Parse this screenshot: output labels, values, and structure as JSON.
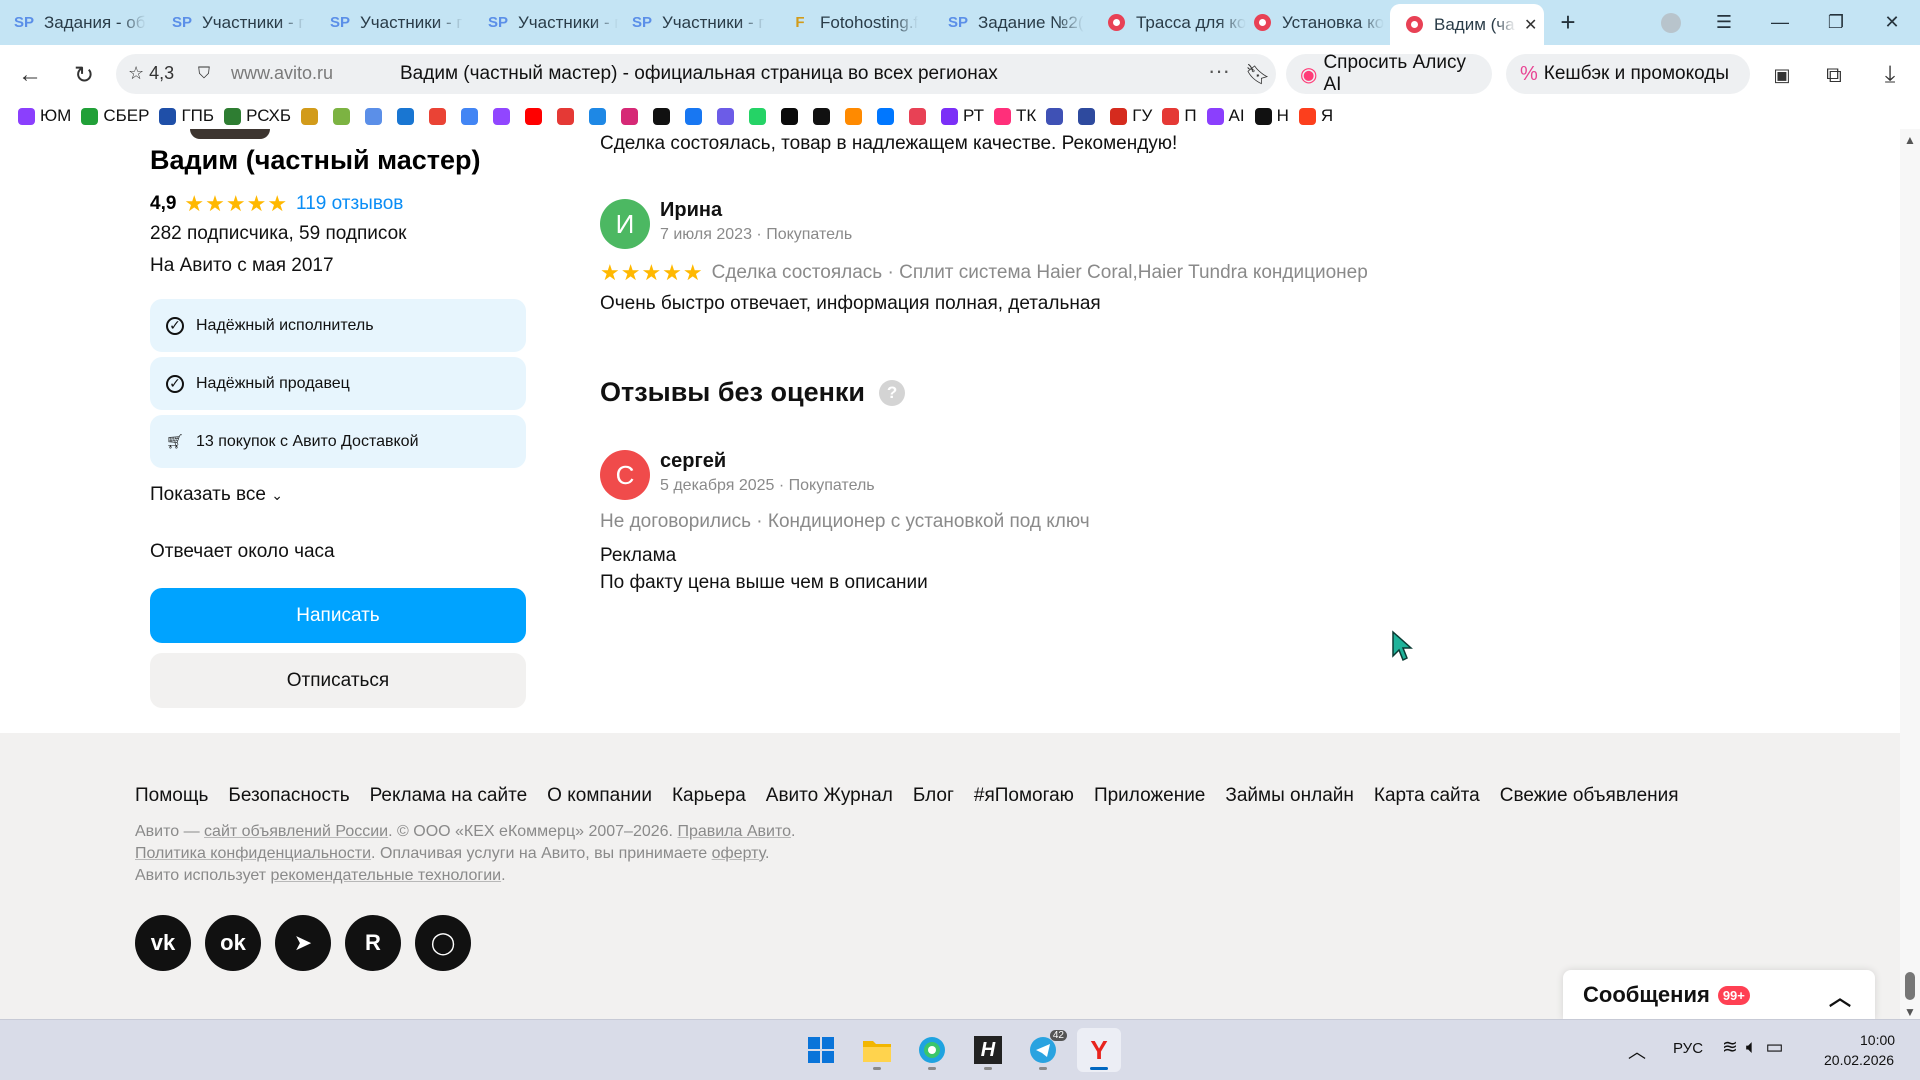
{
  "browser": {
    "tabs": [
      {
        "icon": "sp-icon",
        "title": "Задания - об"
      },
      {
        "icon": "sp-icon",
        "title": "Участники - г"
      },
      {
        "icon": "sp-icon",
        "title": "Участники - г"
      },
      {
        "icon": "sp-icon",
        "title": "Участники - г"
      },
      {
        "icon": "sp-icon",
        "title": "Участники - г"
      },
      {
        "icon": "fotohosting-icon",
        "title": "Fotohosting.f"
      },
      {
        "icon": "sp-icon",
        "title": "Задание №2("
      },
      {
        "icon": "avito-icon",
        "title": "Трасса для ко"
      },
      {
        "icon": "avito-icon",
        "title": "Установка ко"
      },
      {
        "icon": "avito-icon",
        "title": "Вадим (ча",
        "active": true
      }
    ],
    "address": {
      "rating": "4,3",
      "host": "www.avito.ru",
      "title": "Вадим (частный мастер) - официальная страница во всех регионах"
    },
    "alice_label": "Спросить Алису AI",
    "cashback_label": "Кешбэк и промокоды",
    "bookmarks": [
      {
        "label": "ЮМ",
        "color": "#8b3ffd"
      },
      {
        "label": "СБЕР",
        "color": "#21a038"
      },
      {
        "label": "ГПБ",
        "color": "#1f4fa8"
      },
      {
        "label": "РСХБ",
        "color": "#2e7d32"
      },
      {
        "label": "",
        "color": "#d29b1a"
      },
      {
        "label": "",
        "color": "#7cb342"
      },
      {
        "label": "",
        "color": "#5b8fe8"
      },
      {
        "label": "",
        "color": "#1976d2"
      },
      {
        "label": "",
        "color": "#ea4335"
      },
      {
        "label": "",
        "color": "#4285f4"
      },
      {
        "label": "",
        "color": "#9146ff"
      },
      {
        "label": "",
        "color": "#ff0000"
      },
      {
        "label": "",
        "color": "#e53935"
      },
      {
        "label": "",
        "color": "#1e88e5"
      },
      {
        "label": "",
        "color": "#d62976"
      },
      {
        "label": "",
        "color": "#111111"
      },
      {
        "label": "",
        "color": "#1877f2"
      },
      {
        "label": "",
        "color": "#6c5ce7"
      },
      {
        "label": "",
        "color": "#25d366"
      },
      {
        "label": "",
        "color": "#0a0a0a"
      },
      {
        "label": "",
        "color": "#111111"
      },
      {
        "label": "",
        "color": "#ff8a00"
      },
      {
        "label": "",
        "color": "#0077ff"
      },
      {
        "label": "",
        "color": "#e84155"
      },
      {
        "label": "РТ",
        "color": "#7b2ff7"
      },
      {
        "label": "ТК",
        "color": "#ff2f7a"
      },
      {
        "label": "",
        "color": "#3f51b5"
      },
      {
        "label": "",
        "color": "#2e4a9e"
      },
      {
        "label": "ГУ",
        "color": "#d52b1e"
      },
      {
        "label": "П",
        "color": "#e53935"
      },
      {
        "label": "AI",
        "color": "#8b3ffd"
      },
      {
        "label": "Н",
        "color": "#111111"
      },
      {
        "label": "Я",
        "color": "#fc3f1d"
      }
    ]
  },
  "seller": {
    "name": "Вадим (частный мастер)",
    "rating": "4,9",
    "stars": "★★★★★",
    "reviews_link": "119 отзывов",
    "subscribers": "282 подписчика, 59 подписок",
    "since": "На Авито с мая 2017",
    "badges": [
      {
        "icon": "check-circle-icon",
        "label": "Надёжный исполнитель"
      },
      {
        "icon": "check-circle-icon",
        "label": "Надёжный продавец"
      },
      {
        "icon": "cart-icon",
        "label": "13 покупок с Авито Доставкой"
      }
    ],
    "show_all": "Показать все",
    "responds": "Отвечает около часа",
    "write_button": "Написать",
    "unsubscribe_button": "Отписаться"
  },
  "reviews": {
    "prev_text": "Сделка состоялась, товар в надлежащем качестве. Рекомендую!",
    "irina": {
      "initial": "И",
      "name": "Ирина",
      "meta": "7 июля 2023 · Покупатель",
      "stars": "★★★★★",
      "deal": "Сделка состоялась · Сплит система Haier Coral,Haier Tundra кондиционер",
      "text": "Очень быстро отвечает, информация полная, детальная"
    },
    "no_score_title": "Отзывы без оценки",
    "help_icon": "?",
    "sergey": {
      "initial": "С",
      "name": "сергей",
      "meta": "5 декабря 2025 · Покупатель",
      "deal": "Не договорились · Кондиционер с установкой под ключ",
      "text_1": "Реклама",
      "text_2": "По факту цена выше чем в описании"
    }
  },
  "footer": {
    "links": [
      "Помощь",
      "Безопасность",
      "Реклама на сайте",
      "О компании",
      "Карьера",
      "Авито Журнал",
      "Блог",
      "#яПомогаю",
      "Приложение",
      "Займы онлайн",
      "Карта сайта",
      "Свежие объявления"
    ],
    "line1_a": "Авито — ",
    "line1_link1": "сайт объявлений России",
    "line1_b": ". © ООО «КЕХ еКоммерц» 2007–2026. ",
    "line1_link2": "Правила Авито",
    "line1_c": ".",
    "line2_link1": "Политика конфиденциальности",
    "line2_b": ". Оплачивая услуги на Авито, вы принимаете ",
    "line2_link2": "оферту",
    "line2_c": ".",
    "line3_a": "Авито использует ",
    "line3_link": "рекомендательные технологии",
    "line3_c": ".",
    "social": [
      "vk-icon",
      "ok-icon",
      "telegram-icon",
      "rutube-icon",
      "max-icon"
    ]
  },
  "messages": {
    "label": "Сообщения",
    "count": "99+"
  },
  "taskbar": {
    "apps": [
      "windows-start-icon",
      "file-explorer-icon",
      "edge-icon",
      "h-app-icon",
      "telegram-icon",
      "yandex-browser-icon"
    ],
    "telegram_badge": "42",
    "lang": "РУС",
    "time": "10:00",
    "date": "20.02.2026"
  }
}
